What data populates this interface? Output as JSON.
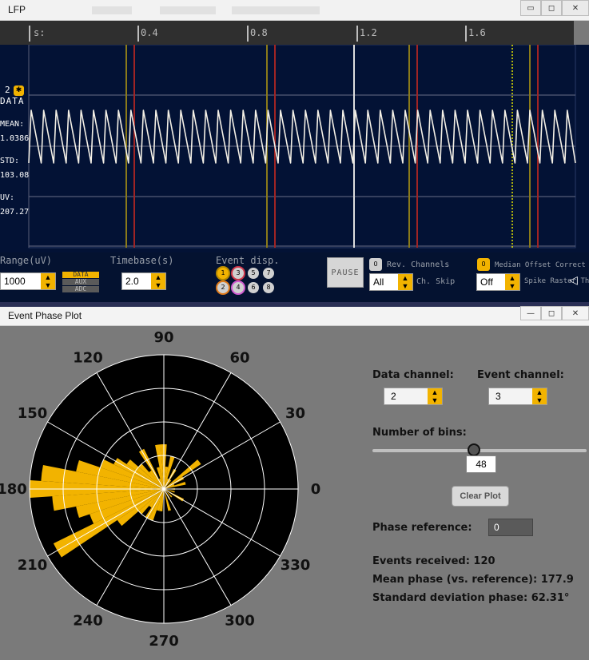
{
  "lfp_window": {
    "title": "LFP",
    "window_buttons": {
      "minimize": "▭",
      "maximize": "◻",
      "close": "✕"
    },
    "timeline": {
      "prefix": "s:",
      "ticks": [
        "0.4",
        "0.8",
        "1.2",
        "1.6"
      ]
    },
    "channel": {
      "number": "2",
      "badge": "✱",
      "data_label": "DATA",
      "mean_label": "MEAN:",
      "mean_value": "1.0386",
      "std_label": "STD:",
      "std_value": "103.08",
      "uv_label": "UV:",
      "uv_value": "207.27"
    },
    "controls": {
      "range_label": "Range(uV)",
      "range_value": "1000",
      "range_type": [
        "DATA",
        "AUX",
        "ADC"
      ],
      "timebase_label": "Timebase(s)",
      "timebase_value": "2.0",
      "event_disp_label": "Event disp.",
      "event_buttons": [
        "1",
        "3",
        "5",
        "7",
        "2",
        "4",
        "6",
        "8"
      ],
      "pause_label": "PAUSE",
      "rev_toggle": "0",
      "rev_label": "Rev. Channels",
      "ch_skip_value": "All",
      "ch_skip_label": "Ch. Skip",
      "median_toggle": "0",
      "median_label": "Median Offset Correct",
      "spike_value": "Off",
      "spike_label": "Spike Raster Thr",
      "collapse_icon": "◁"
    }
  },
  "event_phase_window": {
    "title": "Event Phase Plot",
    "window_buttons": {
      "minimize": "—",
      "maximize": "◻",
      "close": "✕"
    },
    "polar_labels": {
      "0": "0",
      "30": "30",
      "60": "60",
      "90": "90",
      "120": "120",
      "150": "150",
      "180": "180",
      "210": "210",
      "240": "240",
      "270": "270",
      "300": "300",
      "330": "330"
    },
    "data_channel_label": "Data channel:",
    "data_channel_value": "2",
    "event_channel_label": "Event channel:",
    "event_channel_value": "3",
    "bins_label": "Number of bins:",
    "bins_value": "48",
    "bins_slider": {
      "min": 1,
      "max": 100,
      "value": 48
    },
    "clear_label": "Clear Plot",
    "phase_ref_label": "Phase reference:",
    "phase_ref_value": "0",
    "events_received": "Events received: 120",
    "mean_phase": "Mean phase (vs. reference): 177.9",
    "std_phase": "Standard deviation phase: 62.31°",
    "colors": {
      "bars": "#f2b300",
      "plot_bg": "#000000",
      "grid": "#ffffff"
    }
  },
  "chart_data": {
    "type": "polar-histogram",
    "title": "",
    "angular_ticks_deg": [
      0,
      30,
      60,
      90,
      120,
      150,
      180,
      210,
      240,
      270,
      300,
      330
    ],
    "bins": 48,
    "bin_width_deg": 7.5,
    "bins_deg": [
      0,
      15,
      22.5,
      30,
      37.5,
      52.5,
      60,
      67.5,
      75,
      82.5,
      90,
      97.5,
      105,
      112.5,
      120,
      127.5,
      135,
      142.5,
      150,
      157.5,
      165,
      172.5,
      180,
      187.5,
      195,
      202.5,
      210,
      217.5,
      225,
      232.5,
      240,
      247.5,
      255,
      262.5,
      285,
      300,
      315,
      330,
      345
    ],
    "counts": [
      1,
      2,
      1,
      2,
      4,
      1,
      2,
      1,
      3,
      2,
      4,
      4,
      2,
      1,
      4,
      2,
      3,
      4,
      5,
      6,
      8,
      11,
      12,
      10,
      8,
      7,
      11,
      5,
      3,
      2,
      3,
      3,
      2,
      2,
      2,
      1,
      1,
      2,
      1
    ],
    "rmax": 12,
    "radial_rings": 3
  }
}
